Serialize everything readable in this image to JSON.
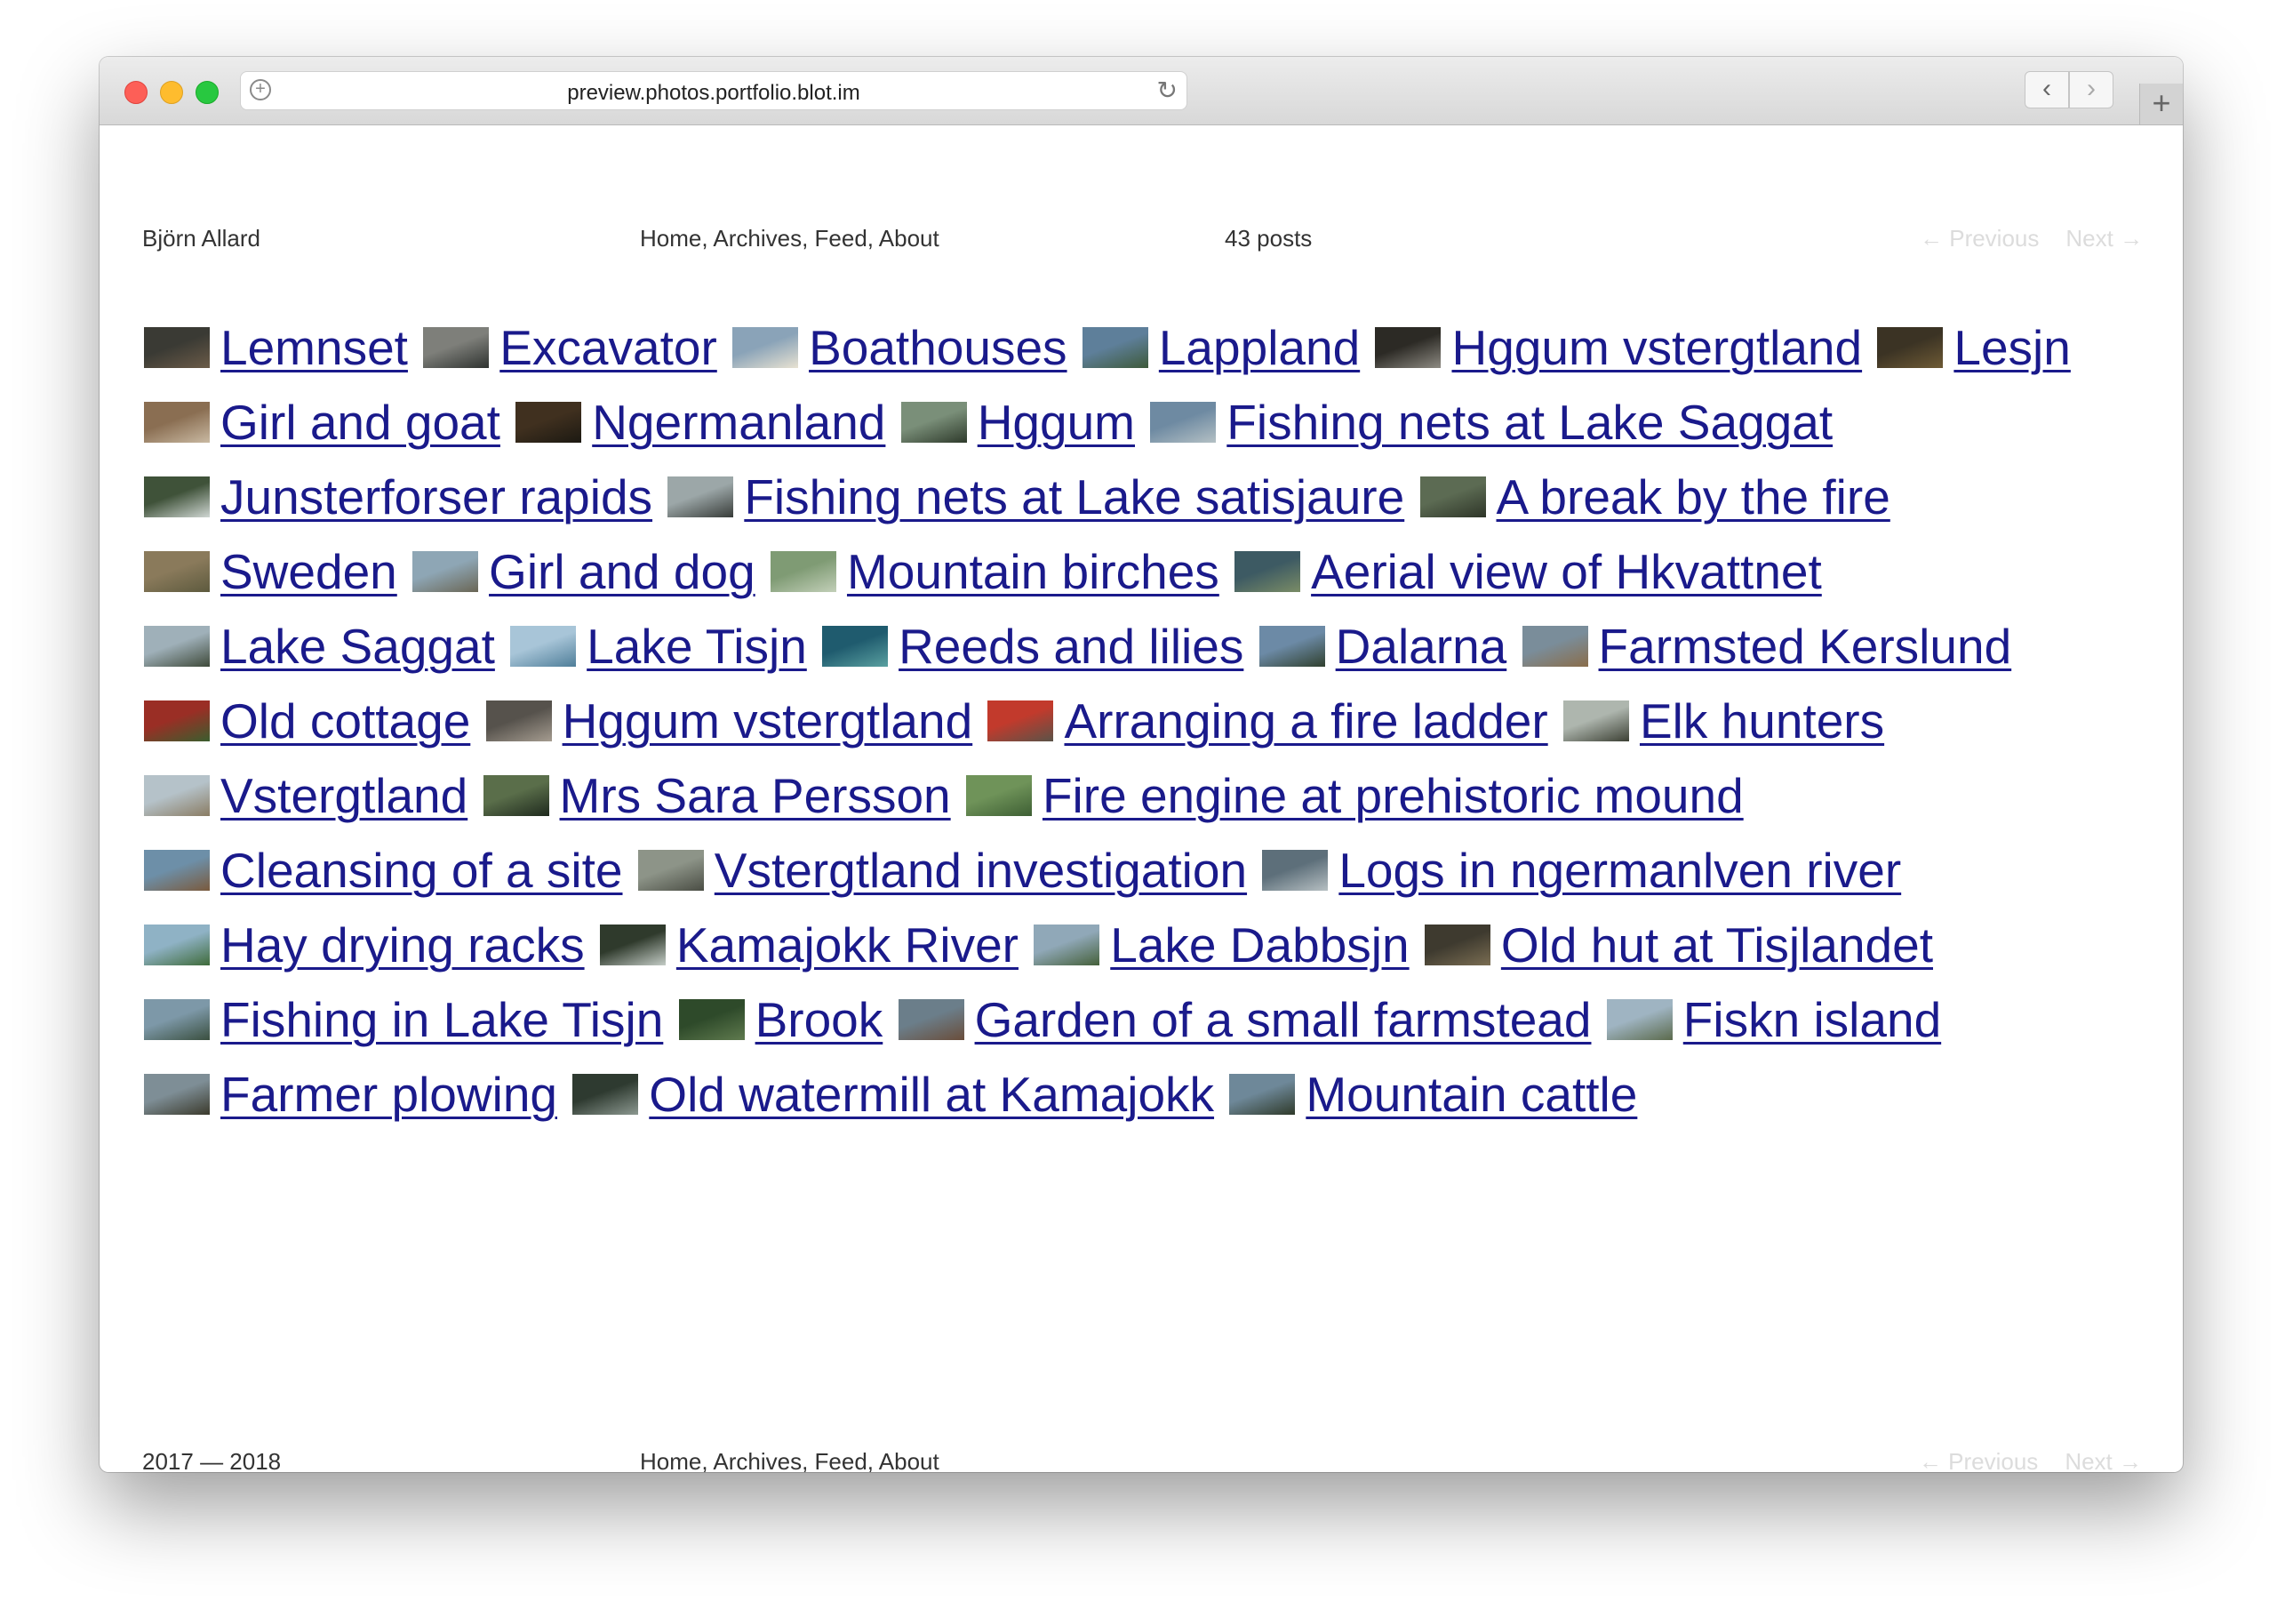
{
  "browser": {
    "url": "preview.photos.portfolio.blot.im",
    "back_glyph": "‹",
    "forward_glyph": "›",
    "new_tab_glyph": "+",
    "reload_glyph": "↻",
    "add_glyph": "+"
  },
  "header": {
    "author": "Björn Allard",
    "nav": "Home, Archives, Feed, About",
    "post_count": "43 posts",
    "previous": "← Previous",
    "next": "Next →"
  },
  "posts": [
    {
      "title": "Lemnset",
      "thumb": [
        "#3a3a34",
        "#6b5b48"
      ]
    },
    {
      "title": "Excavator",
      "thumb": [
        "#7e7f7a",
        "#2f3330"
      ]
    },
    {
      "title": "Boathouses",
      "thumb": [
        "#8aa3b8",
        "#e8e2d2"
      ]
    },
    {
      "title": "Lappland",
      "thumb": [
        "#5e7f9a",
        "#3e5a3a"
      ]
    },
    {
      "title": "Hggum vstergtland",
      "thumb": [
        "#2c2a25",
        "#8d8a82"
      ]
    },
    {
      "title": "Lesjn",
      "thumb": [
        "#3b3324",
        "#6e5a35"
      ]
    },
    {
      "title": "Girl and goat",
      "thumb": [
        "#8a6e52",
        "#c9b9a2"
      ]
    },
    {
      "title": "Ngermanland",
      "thumb": [
        "#40301f",
        "#1c1912"
      ]
    },
    {
      "title": "Hggum",
      "thumb": [
        "#7a8f79",
        "#2e3a2b"
      ]
    },
    {
      "title": "Fishing nets at Lake Saggat",
      "thumb": [
        "#6e8aa2",
        "#b4c0c4"
      ]
    },
    {
      "title": "Junsterforser rapids",
      "thumb": [
        "#3f5239",
        "#cfd6d2"
      ]
    },
    {
      "title": "Fishing nets at Lake satisjaure",
      "thumb": [
        "#9ca7a8",
        "#383c39"
      ]
    },
    {
      "title": "A break by the fire",
      "thumb": [
        "#5c6b53",
        "#2e3528"
      ]
    },
    {
      "title": "Sweden",
      "thumb": [
        "#8a7a5b",
        "#5d5a3e"
      ]
    },
    {
      "title": "Girl and dog",
      "thumb": [
        "#8ea6b5",
        "#6a6655"
      ]
    },
    {
      "title": "Mountain birches",
      "thumb": [
        "#7f9b74",
        "#c2cfb8"
      ]
    },
    {
      "title": "Aerial view of Hkvattnet",
      "thumb": [
        "#3d5a63",
        "#7a8c66"
      ]
    },
    {
      "title": "Lake Saggat",
      "thumb": [
        "#9fb0b9",
        "#3f4a3a"
      ]
    },
    {
      "title": "Lake Tisjn",
      "thumb": [
        "#a8c5d8",
        "#4f7e99"
      ]
    },
    {
      "title": "Reeds and lilies",
      "thumb": [
        "#1f5b6e",
        "#5aa0a0"
      ]
    },
    {
      "title": "Dalarna",
      "thumb": [
        "#6c8aa6",
        "#30402e"
      ]
    },
    {
      "title": "Farmsted Kerslund",
      "thumb": [
        "#7a8d9a",
        "#8a6d4a"
      ]
    },
    {
      "title": "Old cottage",
      "thumb": [
        "#9a2e25",
        "#3a5e2e"
      ]
    },
    {
      "title": "Hggum vstergtland",
      "thumb": [
        "#56524c",
        "#a59c90"
      ]
    },
    {
      "title": "Arranging a fire ladder",
      "thumb": [
        "#c23a2c",
        "#5a5348"
      ]
    },
    {
      "title": "Elk hunters",
      "thumb": [
        "#aeb6ae",
        "#3c4034"
      ]
    },
    {
      "title": "Vstergtland",
      "thumb": [
        "#b5c2c9",
        "#8a7c63"
      ]
    },
    {
      "title": "Mrs Sara Persson",
      "thumb": [
        "#5a6e4a",
        "#1f2a1e"
      ]
    },
    {
      "title": "Fire engine at prehistoric mound",
      "thumb": [
        "#6f9359",
        "#3e5f34"
      ]
    },
    {
      "title": "Cleansing of a site",
      "thumb": [
        "#6d8fa8",
        "#7a5a3d"
      ]
    },
    {
      "title": "Vstergtland investigation",
      "thumb": [
        "#8d9488",
        "#4a4d44"
      ]
    },
    {
      "title": "Logs in ngermanlven river",
      "thumb": [
        "#5d6f7a",
        "#b6bfc2"
      ]
    },
    {
      "title": "Hay drying racks",
      "thumb": [
        "#8fb2c5",
        "#3f6b3a"
      ]
    },
    {
      "title": "Kamajokk River",
      "thumb": [
        "#2f3a2c",
        "#c4ccc6"
      ]
    },
    {
      "title": "Lake Dabbsjn",
      "thumb": [
        "#90a8b8",
        "#45603a"
      ]
    },
    {
      "title": "Old hut at Tisjlandet",
      "thumb": [
        "#3e3a2f",
        "#7a6d52"
      ]
    },
    {
      "title": "Fishing in Lake Tisjn",
      "thumb": [
        "#7d98a8",
        "#3a4f3f"
      ]
    },
    {
      "title": "Brook",
      "thumb": [
        "#2e4a2a",
        "#5f7a4e"
      ]
    },
    {
      "title": "Garden of a small farmstead",
      "thumb": [
        "#6b7e8a",
        "#6a4d3a"
      ]
    },
    {
      "title": "Fiskn island",
      "thumb": [
        "#9fb4c2",
        "#5b6a4c"
      ]
    },
    {
      "title": "Farmer plowing",
      "thumb": [
        "#7e8e96",
        "#3b3a2c"
      ]
    },
    {
      "title": "Old watermill at Kamajokk",
      "thumb": [
        "#2e3a30",
        "#8c9890"
      ]
    },
    {
      "title": "Mountain cattle",
      "thumb": [
        "#6e8899",
        "#2f3a2a"
      ]
    }
  ],
  "footer": {
    "years": "2017 — 2018",
    "nav": "Home, Archives, Feed, About",
    "previous": "← Previous",
    "next": "Next →"
  }
}
